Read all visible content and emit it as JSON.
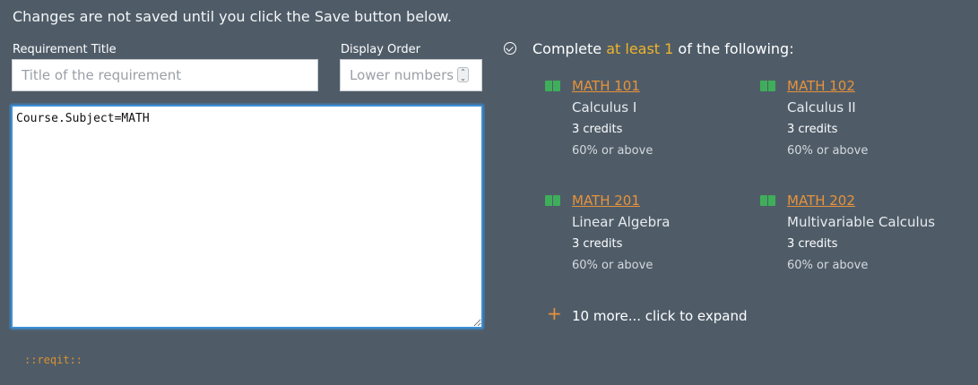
{
  "notice": "Changes are not saved until you click the Save button below.",
  "form": {
    "title_label": "Requirement Title",
    "title_placeholder": "Title of the requirement",
    "order_label": "Display Order",
    "order_placeholder": "Lower numbers",
    "query_value": "Course.Subject=MATH"
  },
  "brand": "::reqit::",
  "preview": {
    "prefix": "Complete ",
    "highlight": "at least 1",
    "suffix": " of the following:",
    "courses": [
      {
        "code": "MATH 101",
        "name": "Calculus I",
        "credits": "3 credits",
        "grade": "60% or above"
      },
      {
        "code": "MATH 102",
        "name": "Calculus II",
        "credits": "3 credits",
        "grade": "60% or above"
      },
      {
        "code": "MATH 201",
        "name": "Linear Algebra",
        "credits": "3 credits",
        "grade": "60% or above"
      },
      {
        "code": "MATH 202",
        "name": "Multivariable Calculus",
        "credits": "3 credits",
        "grade": "60% or above"
      }
    ],
    "more": "10 more... click to expand",
    "icons": {
      "status": "check-circle-icon",
      "course": "book-icon",
      "expand": "plus-icon"
    },
    "colors": {
      "link": "#e8923a",
      "highlight": "#f0b429",
      "book": "#3fae5a",
      "focus": "#3b8fd9"
    }
  }
}
